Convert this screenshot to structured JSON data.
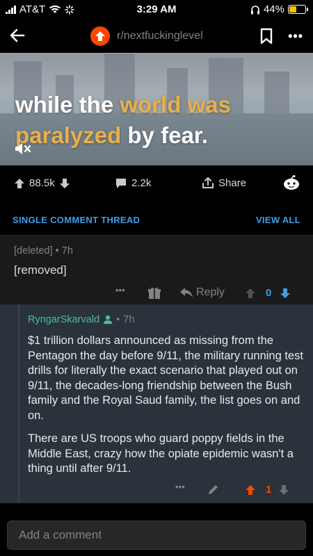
{
  "status_bar": {
    "carrier": "AT&T",
    "time": "3:29 AM",
    "battery": "44%"
  },
  "nav": {
    "subreddit": "r/nextfuckinglevel"
  },
  "video": {
    "caption_line1_a": "while the ",
    "caption_line1_b": "world was",
    "caption_line2_a": "paralyzed",
    "caption_line2_b": " by fear."
  },
  "actions": {
    "score": "88.5k",
    "comments": "2.2k",
    "share_label": "Share"
  },
  "thread": {
    "single_label": "SINGLE COMMENT THREAD",
    "view_all": "VIEW ALL"
  },
  "comment1": {
    "author": "[deleted]",
    "age": "7h",
    "body": "[removed]",
    "reply_label": "Reply",
    "score": "0"
  },
  "comment2": {
    "author": "RyngarSkarvald",
    "age": "7h",
    "paragraph1": "$1 trillion dollars announced as missing from the Pentagon the day before 9/11, the military running test drills for literally the exact scenario that played out on 9/11, the decades-long friendship between the Bush family and the Royal Saud family, the list goes on and on.",
    "paragraph2": "There are US troops who guard poppy fields in the Middle East, crazy how the opiate epidemic wasn't a thing until after 9/11.",
    "score": "1"
  },
  "composer": {
    "placeholder": "Add a comment"
  },
  "colors": {
    "upvote": "#ff4500",
    "link_blue": "#3d9ee6",
    "vote_blue": "#3d9ee6",
    "user_green": "#4bbf9a"
  }
}
